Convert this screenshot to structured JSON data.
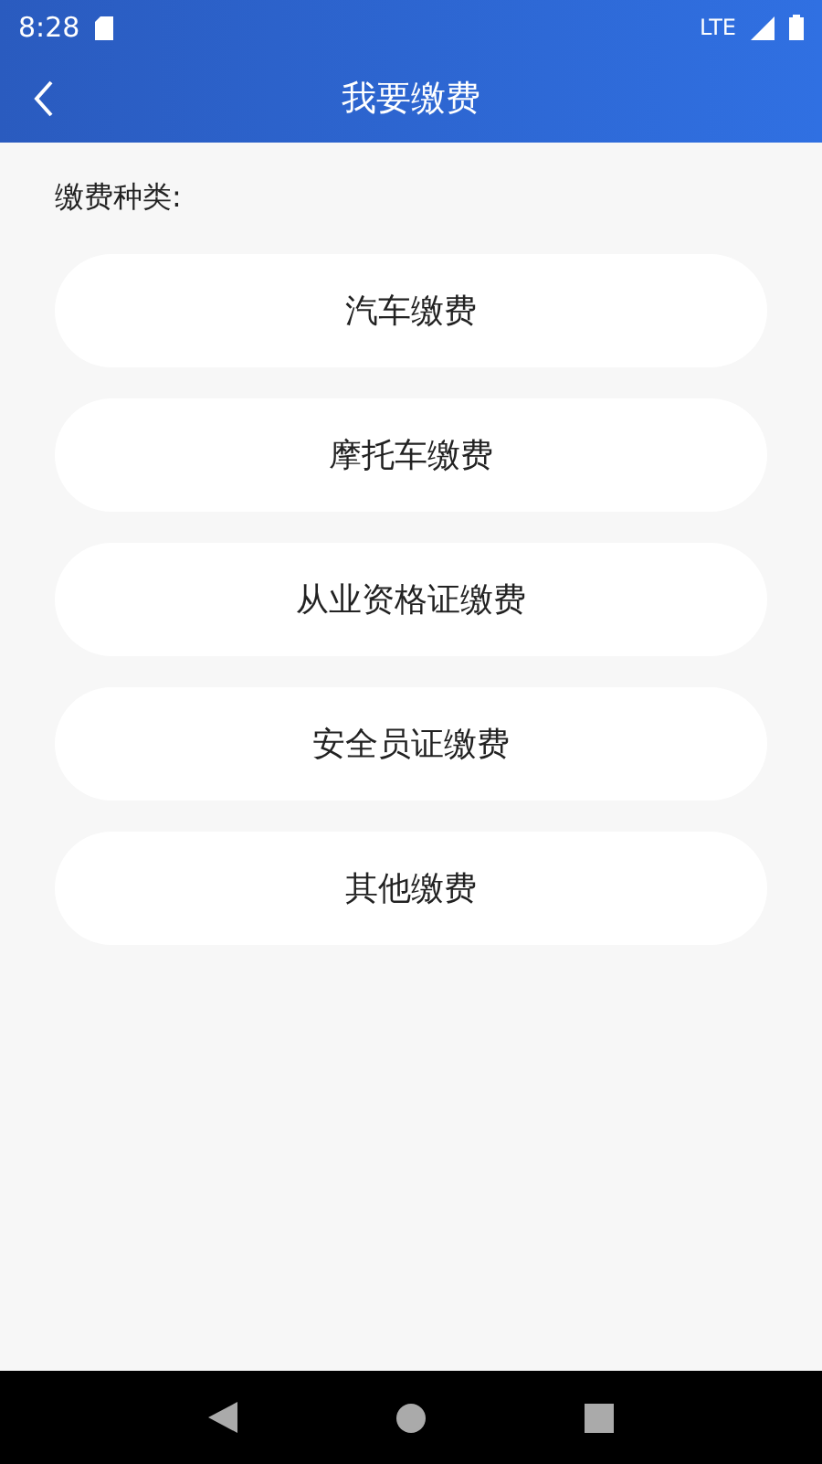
{
  "status_bar": {
    "time": "8:28",
    "network": "LTE"
  },
  "header": {
    "title": "我要缴费"
  },
  "section_label": "缴费种类:",
  "options": [
    {
      "label": "汽车缴费"
    },
    {
      "label": "摩托车缴费"
    },
    {
      "label": "从业资格证缴费"
    },
    {
      "label": "安全员证缴费"
    },
    {
      "label": "其他缴费"
    }
  ]
}
